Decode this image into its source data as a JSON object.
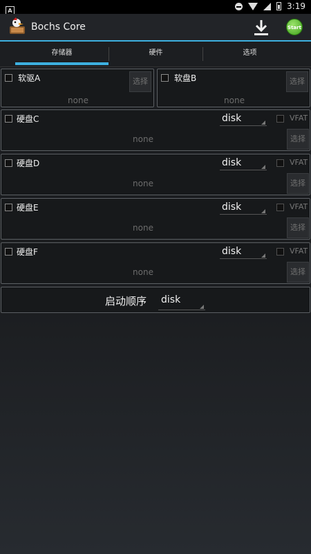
{
  "status_bar": {
    "time": "3:19"
  },
  "app": {
    "title": "Bochs Core",
    "start_label": "Start"
  },
  "tabs": [
    {
      "label": "存储器",
      "selected": true
    },
    {
      "label": "硬件",
      "selected": false
    },
    {
      "label": "选项",
      "selected": false
    }
  ],
  "floppies": [
    {
      "label": "软驱A",
      "path": "none",
      "select_label": "选择"
    },
    {
      "label": "软盘B",
      "path": "none",
      "select_label": "选择"
    }
  ],
  "hard_disks": [
    {
      "label": "硬盘C",
      "type": "disk",
      "vfat_label": "VFAT",
      "path": "none",
      "select_label": "选择"
    },
    {
      "label": "硬盘D",
      "type": "disk",
      "vfat_label": "VFAT",
      "path": "none",
      "select_label": "选择"
    },
    {
      "label": "硬盘E",
      "type": "disk",
      "vfat_label": "VFAT",
      "path": "none",
      "select_label": "选择"
    },
    {
      "label": "硬盘F",
      "type": "disk",
      "vfat_label": "VFAT",
      "path": "none",
      "select_label": "选择"
    }
  ],
  "boot": {
    "label": "启动顺序",
    "value": "disk"
  },
  "colors": {
    "accent": "#3db0e0",
    "start_button": "#4caf2a"
  },
  "icons": [
    "notification-a-icon",
    "dnd-icon",
    "wifi-icon",
    "signal-icon",
    "battery-icon",
    "bochs-logo-icon",
    "download-icon"
  ]
}
